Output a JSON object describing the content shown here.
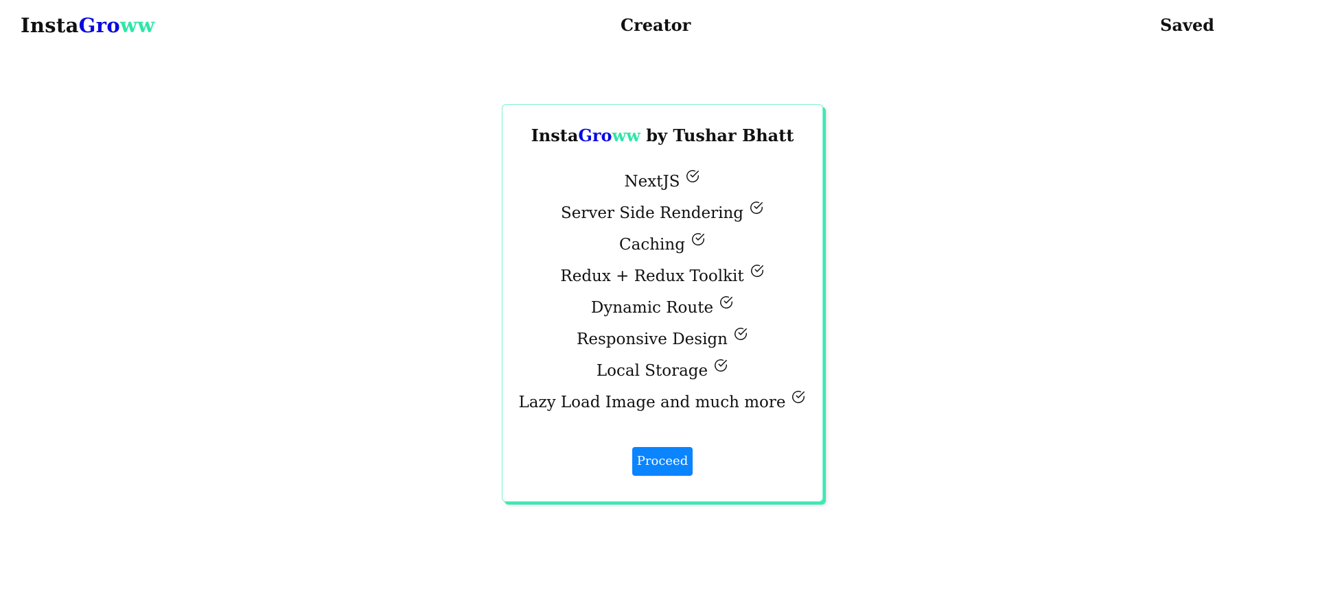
{
  "brand": {
    "part1": "Insta",
    "part2": "Gro",
    "part3": "ww",
    "colors": {
      "insta": "#111111",
      "gro": "#0a0ae0",
      "ww": "#2ee6a8"
    }
  },
  "nav": {
    "creator_label": "Creator",
    "saved_label": "Saved"
  },
  "card": {
    "title_suffix": " by Tushar Bhatt",
    "features": [
      {
        "label": "NextJS",
        "icon": "check-circle-icon"
      },
      {
        "label": "Server Side Rendering",
        "icon": "check-circle-icon"
      },
      {
        "label": "Caching",
        "icon": "check-circle-icon"
      },
      {
        "label": "Redux + Redux Toolkit",
        "icon": "check-circle-icon"
      },
      {
        "label": "Dynamic Route",
        "icon": "check-circle-icon"
      },
      {
        "label": "Responsive Design",
        "icon": "check-circle-icon"
      },
      {
        "label": "Local Storage",
        "icon": "check-circle-icon"
      },
      {
        "label": "Lazy Load Image and much more",
        "icon": "check-circle-icon"
      }
    ],
    "proceed_label": "Proceed",
    "accent_color": "#3ee8b4",
    "button_color": "#0a84ff"
  }
}
